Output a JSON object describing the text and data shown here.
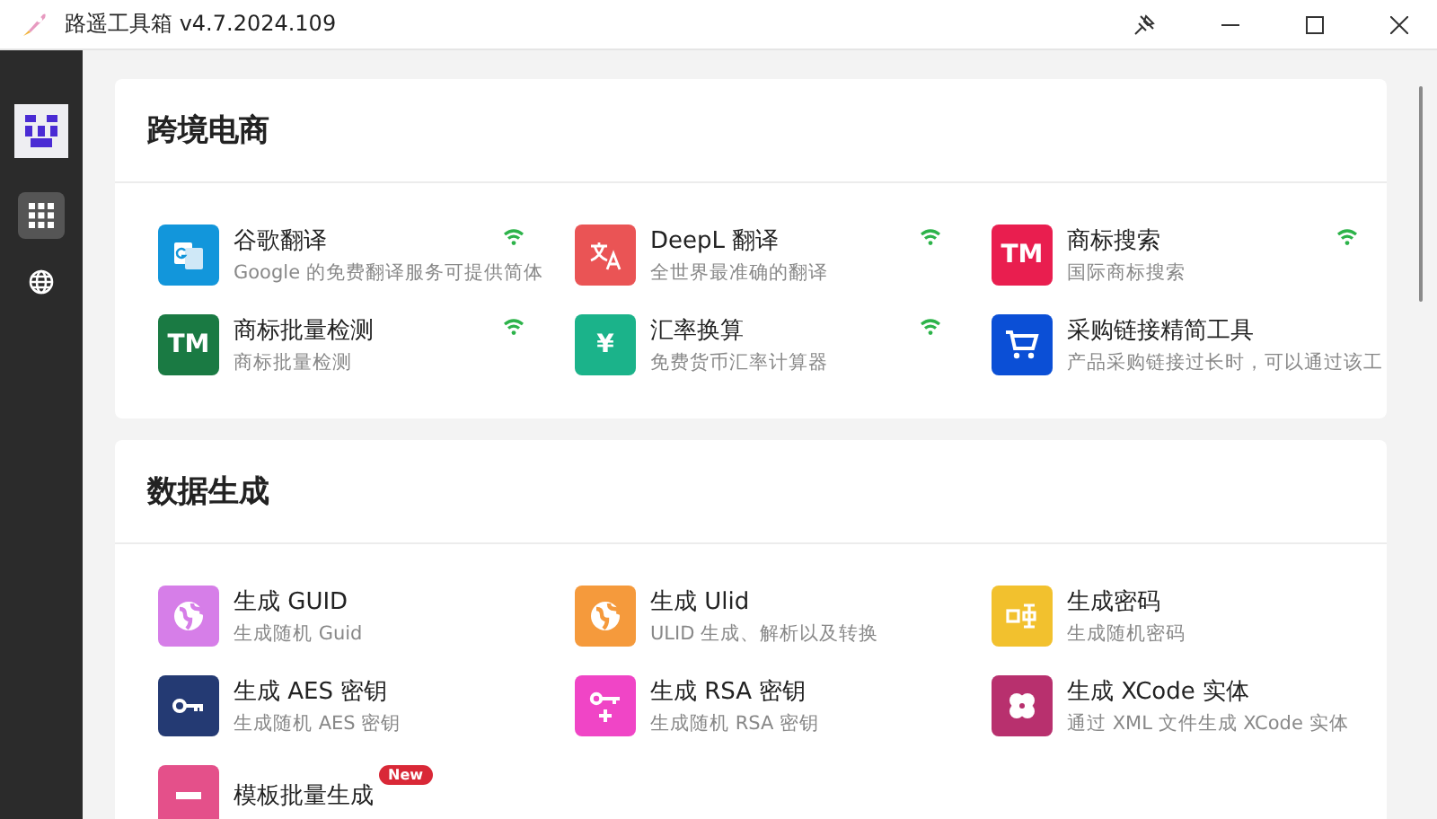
{
  "window": {
    "title": "路遥工具箱 v4.7.2024.109"
  },
  "sidebar": {
    "items": [
      {
        "kind": "grid",
        "selected": true
      },
      {
        "kind": "globe",
        "selected": false
      }
    ]
  },
  "sections": [
    {
      "title": "跨境电商",
      "items": [
        {
          "title": "谷歌翻译",
          "description": "Google 的免费翻译服务可提供简体",
          "kind": "translate",
          "color": "#1296db",
          "online": true
        },
        {
          "title": "DeepL 翻译",
          "description": "全世界最准确的翻译",
          "kind": "deepl",
          "color": "#ea5455",
          "online": true
        },
        {
          "title": "商标搜索",
          "description": "国际商标搜索",
          "kind": "text",
          "icon_text": "TM",
          "color": "#e91e4f",
          "online": true
        },
        {
          "title": "商标批量检测",
          "description": "商标批量检测",
          "kind": "text",
          "icon_text": "TM",
          "color": "#1a7a43",
          "online": true
        },
        {
          "title": "汇率换算",
          "description": "免费货币汇率计算器",
          "kind": "text",
          "icon_text": "¥",
          "color": "#1bb38a",
          "online": true
        },
        {
          "title": "采购链接精简工具",
          "description": "产品采购链接过长时，可以通过该工",
          "kind": "cart",
          "color": "#0b4fd6",
          "online": false
        }
      ]
    },
    {
      "title": "数据生成",
      "items": [
        {
          "title": "生成 GUID",
          "description": "生成随机 Guid",
          "kind": "globe",
          "color": "#d67ee8",
          "online": false
        },
        {
          "title": "生成 Ulid",
          "description": "ULID 生成、解析以及转换",
          "kind": "globe",
          "color": "#f59a3c",
          "online": false
        },
        {
          "title": "生成密码",
          "description": "生成随机密码",
          "kind": "password",
          "color": "#f2c12e",
          "online": false
        },
        {
          "title": "生成 AES 密钥",
          "description": "生成随机 AES 密钥",
          "kind": "key",
          "color": "#243a73",
          "online": false
        },
        {
          "title": "生成 RSA 密钥",
          "description": "生成随机 RSA 密钥",
          "kind": "keyplus",
          "color": "#f045c6",
          "online": false
        },
        {
          "title": "生成 XCode 实体",
          "description": "通过 XML 文件生成 XCode 实体",
          "kind": "clover",
          "color": "#b8306e",
          "online": false
        },
        {
          "title": "模板批量生成",
          "kind": "bar",
          "color": "#e4508a",
          "online": false,
          "badge": "New"
        }
      ]
    }
  ]
}
